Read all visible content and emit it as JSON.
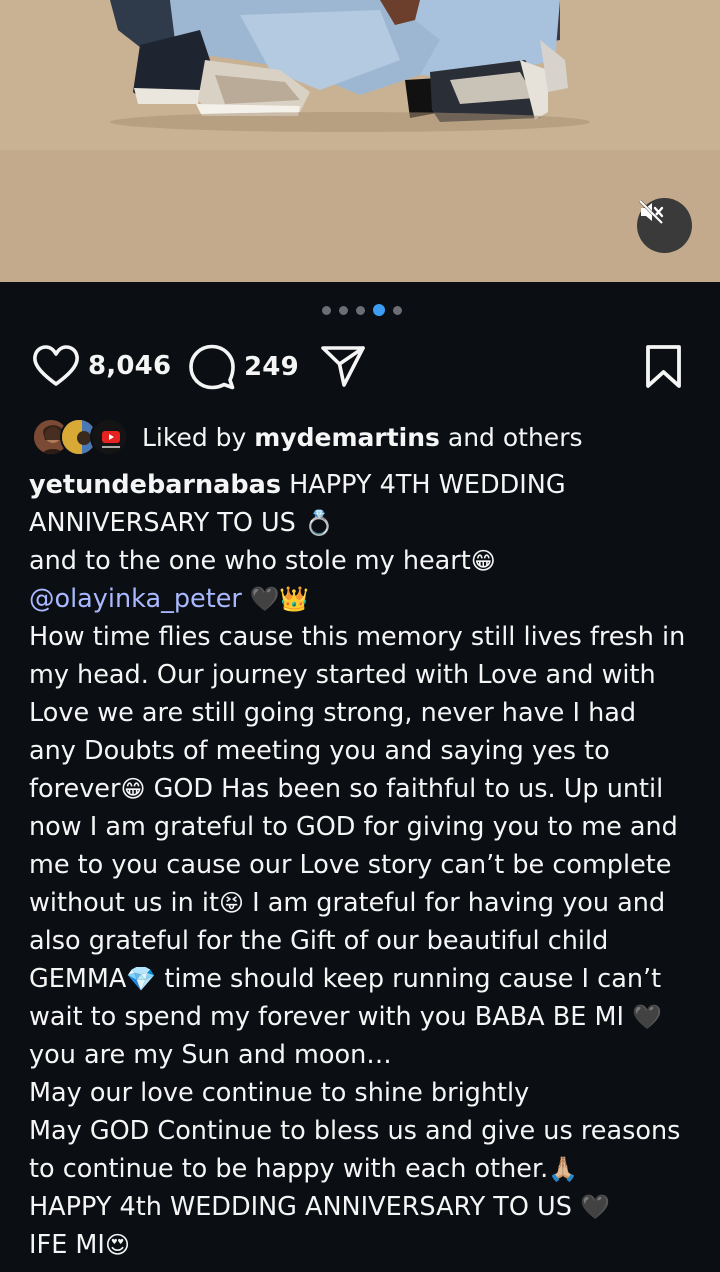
{
  "post": {
    "carousel": {
      "total": 5,
      "active_index": 3
    },
    "likes_count": "8,046",
    "comments_count": "249",
    "liked_by": {
      "prefix": "Liked by ",
      "username": "mydemartins",
      "suffix": " and others"
    }
  },
  "caption": {
    "username": "yetundebarnabas",
    "line1_text": " HAPPY 4TH WEDDING",
    "line2_text": "ANNIVERSARY TO US ",
    "line2_emoji": "💍",
    "line3_text": " and to the one who stole my heart",
    "line3_emoji": "😁",
    "mention": "@olayinka_peter",
    "line4_emoji": " 🖤👑",
    "line5": "How time flies cause this memory still lives fresh in",
    "line6": "my head. Our  journey started with Love and with",
    "line7": "Love we are still going strong, never have I had",
    "line8": "any Doubts of meeting you and saying yes to",
    "line9_pre": "forever",
    "line9_emoji": "😁",
    "line9_post": " GOD Has been so faithful to us. Up until",
    "line10": "now I am grateful to GOD for giving you to me and",
    "line11": "me to you cause our Love story can’t be complete",
    "line12_pre": "without us in it",
    "line12_emoji": "😝",
    "line12_post": " I am grateful for having you and",
    "line13": "also grateful for the Gift of our beautiful child",
    "line14_pre": "GEMMA",
    "line14_emoji": "💎",
    "line14_post": " time should keep running cause I can’t",
    "line15_pre": "wait to spend my forever with you BABA BE MI ",
    "line15_emoji": "🖤",
    "line16": "you are my Sun and moon…",
    "line17": "May our love continue to shine brightly",
    "line18": "May GOD Continue to bless us and give us reasons",
    "line19_pre": "to continue to be happy with each other.",
    "line19_emoji": "🙏🏼",
    "line20_pre": "HAPPY 4th WEDDING ANNIVERSARY TO US ",
    "line20_emoji": "🖤",
    "line21_pre": "IFE MI",
    "line21_emoji": "😍"
  },
  "icons": {
    "like": "heart-outline-icon",
    "comment": "speech-bubble-icon",
    "share": "paper-plane-icon",
    "save": "bookmark-icon",
    "mute": "speaker-muted-icon"
  },
  "colors": {
    "background": "#0b0f14",
    "text": "#f5f5f5",
    "mention": "#a9b8ff",
    "active_dot": "#3d9df2",
    "inactive_dot": "#6b6f75"
  }
}
